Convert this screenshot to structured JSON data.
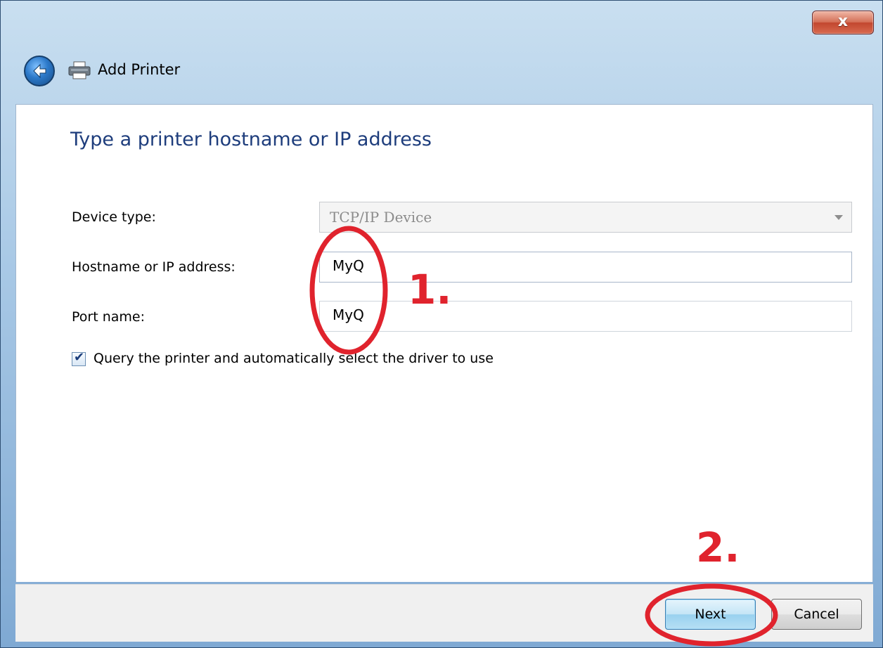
{
  "window": {
    "title": "Add Printer",
    "close_label": "x"
  },
  "page": {
    "heading": "Type a printer hostname or IP address"
  },
  "form": {
    "device_type_label": "Device type:",
    "device_type_value": "TCP/IP Device",
    "hostname_label": "Hostname or IP address:",
    "hostname_value": "MyQ",
    "port_label": "Port name:",
    "port_value": "MyQ",
    "query_checked": true,
    "query_label": "Query the printer and automatically select the driver to use"
  },
  "buttons": {
    "next_label": "Next",
    "cancel_label": "Cancel"
  },
  "annotations": {
    "step1": "1.",
    "step2": "2.",
    "color": "#e0232d"
  },
  "icons": {
    "back": "back-arrow-icon",
    "printer": "printer-icon",
    "close": "close-icon",
    "dropdown": "chevron-down-icon",
    "check": "checkmark-icon"
  }
}
